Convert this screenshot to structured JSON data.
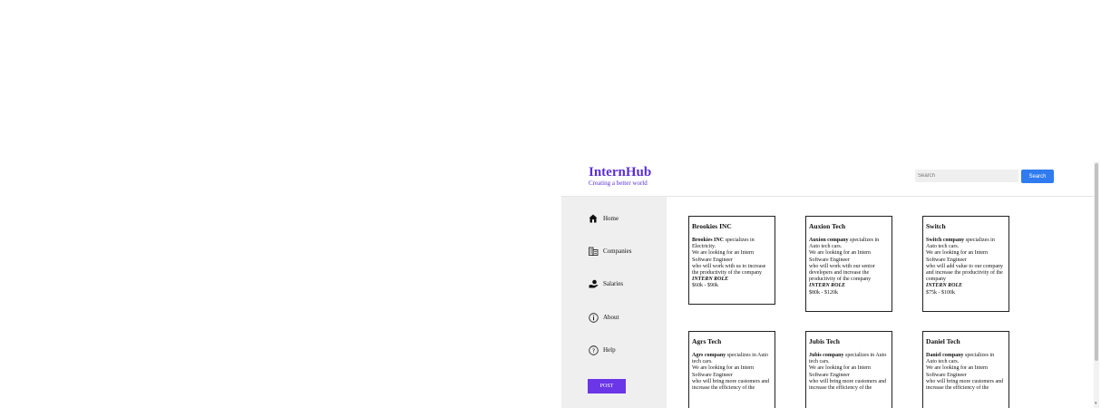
{
  "brand": {
    "title": "InternHub",
    "tagline": "Creating a better world"
  },
  "search": {
    "placeholder": "Search",
    "button_label": "Search"
  },
  "sidebar": {
    "items": [
      {
        "label": "Home",
        "icon": "home-icon"
      },
      {
        "label": "Companies",
        "icon": "building-icon"
      },
      {
        "label": "Salaries",
        "icon": "money-hand-icon"
      },
      {
        "label": "About",
        "icon": "info-icon"
      },
      {
        "label": "Help",
        "icon": "help-icon"
      }
    ],
    "post_label": "POST"
  },
  "colors": {
    "brand": "#5b2fd6",
    "search_button": "#2f7bef",
    "post_button": "#6b35e8"
  },
  "cards": [
    {
      "title": "Brookies INC",
      "company": "Brookies INC",
      "specialty": " specializes in Electricity.",
      "line1": "We are looking for an Intern Software Engineer",
      "line2": "who will work with us to increase the productivity of the company",
      "role": "INTERN ROLE",
      "salary": "$60k - $90k"
    },
    {
      "title": "Auxion Tech",
      "company": "Auxion company",
      "specialty": " specializes in Auto tech cars.",
      "line1": "We are looking for an Intern Software Engineer",
      "line2": "who will work with our senior developers and increase the productivity of the company",
      "role": "INTERN ROLE",
      "salary": "$80k - $120k"
    },
    {
      "title": "Switch",
      "company": "Switch company",
      "specialty": " specializes in Auto tech cars.",
      "line1": "We are looking for an Intern Software Engineer",
      "line2": "who will add value to our company and increase the productivity of the company",
      "role": "INTERN ROLE",
      "salary": "$75k - $100k"
    },
    {
      "title": "Agrs Tech",
      "company": "Agrs company",
      "specialty": " specializes in Auto tech cars.",
      "line1": "We are looking for an Intern Software Engineer",
      "line2": "who will bring more customers and increase the efficiency of the",
      "role": "",
      "salary": ""
    },
    {
      "title": "Jubis Tech",
      "company": "Jubis company",
      "specialty": " specializes in Auto tech cars.",
      "line1": "We are looking for an Intern Software Engineer",
      "line2": "who will bring more customers and increase the efficiency of the",
      "role": "",
      "salary": ""
    },
    {
      "title": "Daniel Tech",
      "company": "Daniel company",
      "specialty": " specializes in Auto tech cars.",
      "line1": "We are looking for an Intern Software Engineer",
      "line2": "who will bring more customers and increase the efficiency of the",
      "role": "",
      "salary": ""
    }
  ]
}
